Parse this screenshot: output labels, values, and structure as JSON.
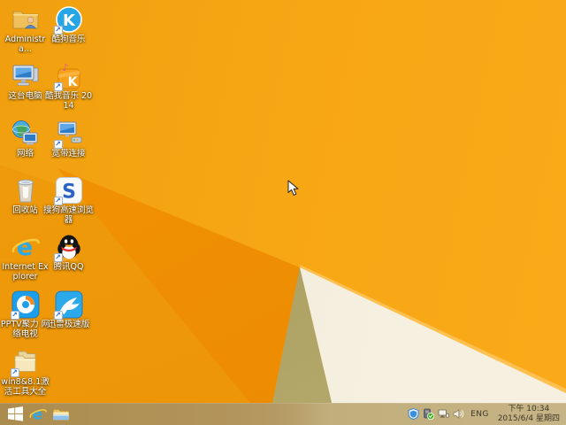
{
  "desktop": {
    "icons": {
      "administrator": {
        "label": "Administra..."
      },
      "kugou": {
        "label": "酷狗音乐"
      },
      "this_pc": {
        "label": "这台电脑"
      },
      "kuwo": {
        "label": "酷我音乐 2014"
      },
      "network": {
        "label": "网络"
      },
      "broadband": {
        "label": "宽带连接"
      },
      "recycle_bin": {
        "label": "回收站"
      },
      "sogou": {
        "label": "搜狗高速浏览器"
      },
      "ie": {
        "label": "Internet Explorer"
      },
      "qq": {
        "label": "腾讯QQ"
      },
      "pptv": {
        "label": "PPTV聚力 网络电视"
      },
      "xunlei": {
        "label": "迅雷极速版"
      },
      "win_tools": {
        "label": "win8&8.1激活工具大全"
      }
    }
  },
  "taskbar": {
    "tray": {
      "language": "ENG",
      "time": "下午 10:34",
      "date": "2015/6/4 星期四"
    }
  },
  "colors": {
    "wallpaper_orange": "#F7A614",
    "wallpaper_deep_orange": "#EC8A00",
    "wallpaper_olive": "#ACA066",
    "wallpaper_cream": "#F2EDDC",
    "taskbar_left": "#AC8C4E",
    "taskbar_right": "#C7B486",
    "tray_text": "#3E3828"
  }
}
